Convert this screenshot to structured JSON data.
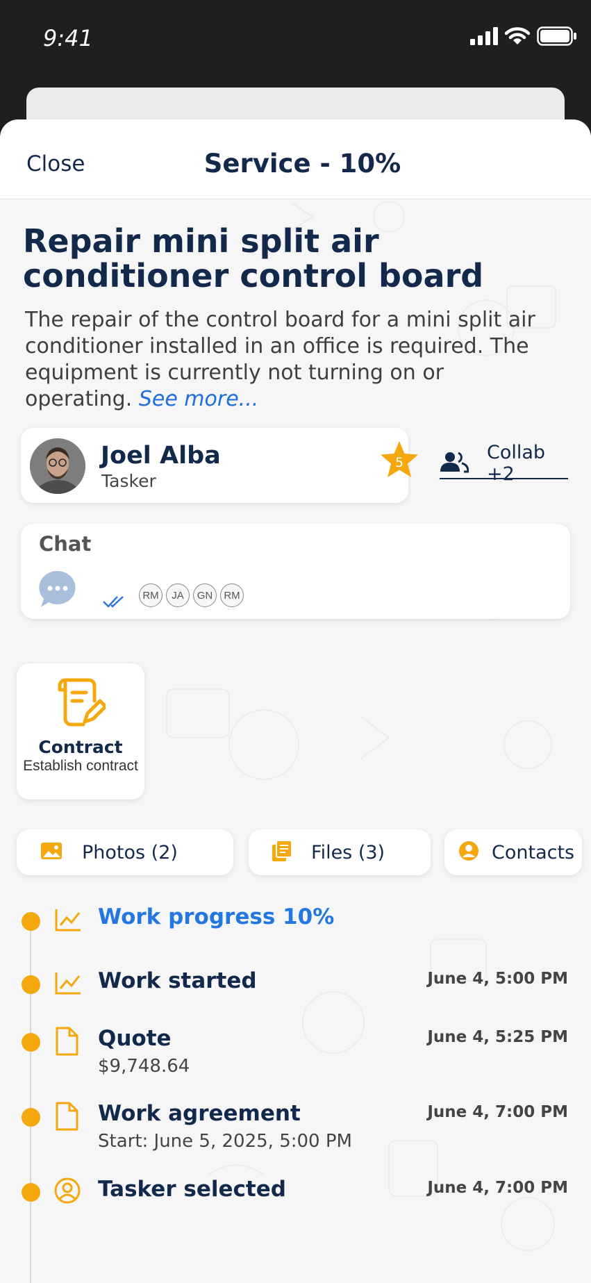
{
  "status_bar": {
    "time": "9:41"
  },
  "header": {
    "close_label": "Close",
    "title": "Service - 10%"
  },
  "task": {
    "title": "Repair mini split air conditioner control board",
    "description": "The repair of the control board for a mini split air conditioner installed in an office is required. The equipment is currently not turning on or operating.",
    "see_more": "See more..."
  },
  "tasker": {
    "name": "Joel Alba",
    "role": "Tasker",
    "rating": "5"
  },
  "collab": {
    "label": "Collab +2"
  },
  "chat": {
    "title": "Chat",
    "participants": [
      "RM",
      "JA",
      "GN",
      "RM"
    ]
  },
  "contract": {
    "title": "Contract",
    "subtitle": "Establish contract"
  },
  "chips": {
    "photos": "Photos (2)",
    "files": "Files (3)",
    "contacts": "Contacts"
  },
  "timeline": [
    {
      "title": "Work progress 10%",
      "icon": "chart-line-icon",
      "date": "",
      "sub": ""
    },
    {
      "title": "Work started",
      "icon": "chart-line-icon",
      "date": "June 4, 5:00 PM",
      "sub": ""
    },
    {
      "title": "Quote",
      "icon": "document-icon",
      "date": "June 4, 5:25 PM",
      "sub": "$9,748.64"
    },
    {
      "title": "Work agreement",
      "icon": "document-icon",
      "date": "June 4, 7:00 PM",
      "sub": "Start: June 5, 2025, 5:00 PM"
    },
    {
      "title": "Tasker selected",
      "icon": "user-circle-icon",
      "date": "June 4, 7:00 PM",
      "sub": ""
    }
  ],
  "colors": {
    "accent": "#f5a70e",
    "primary": "#13294b",
    "link": "#1d6fdc",
    "progress": "#2377e0"
  }
}
